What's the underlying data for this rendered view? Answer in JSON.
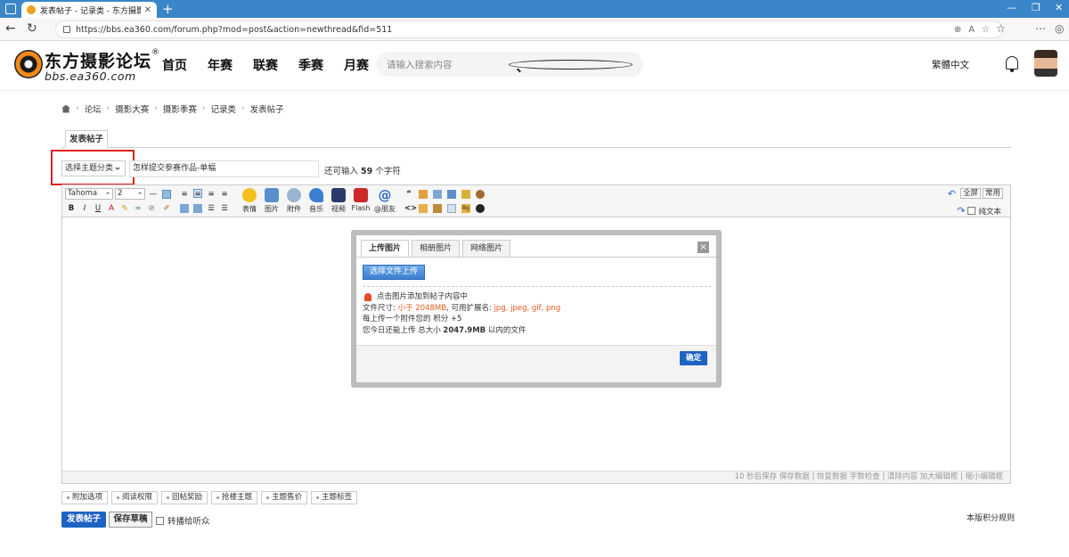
{
  "browser": {
    "tab_title": "发表帖子 - 记录类 - 东方摄影论坛",
    "url": "https://bbs.ea360.com/forum.php?mod=post&action=newthread&fid=511"
  },
  "site": {
    "logo_name": "东方摄影论坛",
    "logo_reg": "®",
    "logo_domain": "bbs.ea360.com",
    "nav": [
      "首页",
      "年赛",
      "联赛",
      "季赛",
      "月赛"
    ],
    "search_placeholder": "请输入搜索内容",
    "lang_link": "繁體中文"
  },
  "breadcrumb": [
    "论坛",
    "摄影大赛",
    "摄影季赛",
    "记录类",
    "发表帖子"
  ],
  "form": {
    "tab_label": "发表帖子",
    "type_select": "选择主题分类",
    "subject_value": "怎样提交参赛作品-单幅",
    "char_prefix": "还可输入",
    "char_count": "59",
    "char_suffix": "个字符"
  },
  "editor": {
    "font_name": "Tahoma",
    "font_size": "2",
    "tools": [
      "表情",
      "图片",
      "附件",
      "音乐",
      "视频",
      "Flash",
      "@朋友"
    ],
    "fullscreen": "全屏",
    "common": "常用",
    "plain_text": "纯文本",
    "status": "10 秒后保存 保存数据 | 恢复数据    字数检查 | 清除内容    加大编辑框 | 缩小编辑框"
  },
  "dialog": {
    "tabs": [
      "上传图片",
      "相册图片",
      "网络图片"
    ],
    "close": "×",
    "choose_button": "选择文件上传",
    "info_line1": "点击图片添加到帖子内容中",
    "size_label": "文件尺寸:",
    "size_value": "小于 2048MB",
    "ext_label": ", 可用扩展名:",
    "ext_value": "jpg, jpeg, gif, png",
    "credit_line": "每上传一个附件您的 积分 +5",
    "quota_prefix": "您今日还能上传 总大小",
    "quota_value": "2047.9MB",
    "quota_suffix": "以内的文件",
    "ok_button": "确定"
  },
  "options": [
    "附加选项",
    "阅读权限",
    "回帖奖励",
    "抢楼主题",
    "主题售价",
    "主题标签"
  ],
  "actions": {
    "submit": "发表帖子",
    "draft": "保存草稿",
    "broadcast": "转播给听众",
    "rules": "本版积分规则"
  },
  "colors": {
    "accent_blue": "#1e63c4",
    "orange_text": "#e8591a",
    "highlight_red": "#e02020"
  }
}
